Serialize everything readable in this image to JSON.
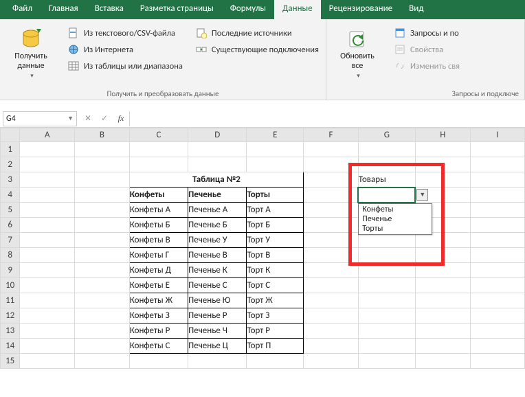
{
  "tabs": [
    "Файл",
    "Главная",
    "Вставка",
    "Разметка страницы",
    "Формулы",
    "Данные",
    "Рецензирование",
    "Вид"
  ],
  "active_tab": "Данные",
  "ribbon": {
    "get_data": {
      "label": "Получить\nданные",
      "group_title": "Получить и преобразовать данные"
    },
    "from_csv": "Из текстового/CSV-файла",
    "from_web": "Из Интернета",
    "from_table": "Из таблицы или диапазона",
    "recent": "Последние источники",
    "existing": "Существующие подключения",
    "refresh": {
      "label": "Обновить\nвсе"
    },
    "queries_group_title": "Запросы и подключе",
    "queries_btn": "Запросы и по",
    "properties_btn": "Свойства",
    "edit_links_btn": "Изменить свя"
  },
  "namebox": "G4",
  "fx_label": "fx",
  "columns": [
    "A",
    "B",
    "C",
    "D",
    "E",
    "F",
    "G",
    "H",
    "I"
  ],
  "row_count": 15,
  "table": {
    "title": "Таблица №2",
    "headers": [
      "Конфеты",
      "Печенье",
      "Торты"
    ],
    "rows": [
      [
        "Конфеты А",
        "Печенье А",
        "Торт А"
      ],
      [
        "Конфеты Б",
        "Печенье Б",
        "Торт Б"
      ],
      [
        "Конфеты В",
        "Печенье У",
        "Торт У"
      ],
      [
        "Конфеты Г",
        "Печенье В",
        "Торт В"
      ],
      [
        "Конфеты Д",
        "Печенье К",
        "Торт К"
      ],
      [
        "Конфеты Е",
        "Печенье С",
        "Торт С"
      ],
      [
        "Конфеты Ж",
        "Печенье Ю",
        "Торт Ж"
      ],
      [
        "Конфеты З",
        "Печенье Р",
        "Торт З"
      ],
      [
        "Конфеты Р",
        "Печенье Ч",
        "Торт Р"
      ],
      [
        "Конфеты С",
        "Печенье Ц",
        "Торт П"
      ]
    ]
  },
  "g3_label": "Товары",
  "dropdown": {
    "options": [
      "Конфеты",
      "Печенье",
      "Торты"
    ]
  }
}
